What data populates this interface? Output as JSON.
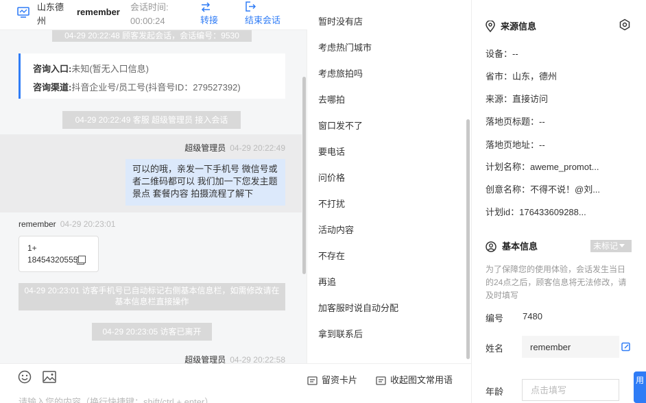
{
  "chat": {
    "header": {
      "city": "山东德州",
      "user": "remember",
      "time_label": "会话时间:",
      "time_value": "00:00:24",
      "transfer_label": "转接",
      "end_label": "结束会话"
    },
    "system_messages": [
      "04-29 20:22:48 顾客发起会话，会话编号：9530",
      "04-29 20:22:49 客服 超级管理员 接入会话",
      "04-29 20:23:01 访客手机号已自动标记右侧基本信息栏，如需修改请在基本信息栏直接操作",
      "04-29 20:23:05 访客已离开"
    ],
    "entry_card": {
      "entry_label": "咨询入口:",
      "entry_value": "未知(暂无入口信息)",
      "channel_label": "咨询渠道:",
      "channel_value": "抖音企业号/员工号(抖音号ID：279527392)"
    },
    "messages": [
      {
        "sender": "超级管理员",
        "time": "04-29 20:22:49",
        "text": "可以的哦，亲发一下手机号 微信号或者二维码都可以 我们加一下您发主题景点 套餐内容 拍摄流程了解下"
      },
      {
        "sender": "remember",
        "time": "04-29 20:23:01",
        "line1": "1+",
        "line2": "18454320555"
      },
      {
        "sender": "超级管理员",
        "time": "04-29 20:22:58"
      }
    ],
    "input_placeholder": "请输入您的内容（换行快捷键：shift/ctrl + enter）"
  },
  "quick_replies": {
    "items": [
      "暂时没有店",
      "考虑热门城市",
      "考虑旅拍吗",
      "去哪拍",
      "窗口发不了",
      "要电话",
      "问价格",
      "不打扰",
      "活动内容",
      "不存在",
      "再追",
      "加客服时说自动分配",
      "拿到联系后"
    ],
    "card_label": "留资卡片",
    "collapse_label": "收起图文常用语"
  },
  "info": {
    "source": {
      "title": "来源信息",
      "device": "设备：--",
      "region": "省市：山东，德州",
      "origin": "来源：直接访问",
      "landing_title": "落地页标题：--",
      "landing_url": "落地页地址：--",
      "plan_name": "计划名称：aweme_promot...",
      "creative_name": "创意名称：不得不说！@刘...",
      "plan_id": "计划id：176433609288..."
    },
    "basic": {
      "title": "基本信息",
      "tag": "未标记",
      "notice": "为了保障您的使用体验，会话发生当日的24点之后，顾客信息将无法修改，请及时填写",
      "id_label": "编号",
      "id_value": "7480",
      "name_label": "姓名",
      "name_value": "remember",
      "age_label": "年龄",
      "age_placeholder": "点击填写",
      "float_label": "用"
    }
  },
  "colors": {
    "accent": "#2f7cf6",
    "system_bg": "#d9d9d9",
    "agent_bubble": "#dce9fb"
  }
}
